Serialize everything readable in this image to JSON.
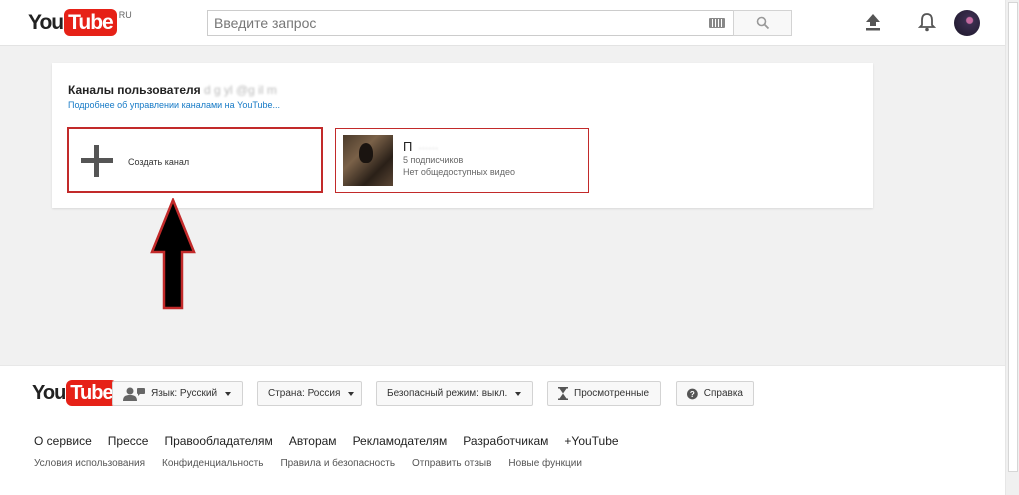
{
  "header": {
    "logo_you": "You",
    "logo_tube": "Tube",
    "logo_region": "RU",
    "search_placeholder": "Введите запрос",
    "icons": [
      "keyboard-icon",
      "search-icon",
      "upload-icon",
      "bell-icon"
    ]
  },
  "card": {
    "title_prefix": "Каналы пользователя",
    "title_hidden": "d g yl @g il m",
    "link": "Подробнее об управлении каналами на YouTube...",
    "create_label": "Создать канал",
    "channel": {
      "name": "П",
      "name_hidden": "······",
      "subscribers": "5 подписчиков",
      "videos": "Нет общедоступных видео"
    }
  },
  "footer": {
    "logo_you": "You",
    "logo_tube": "Tube",
    "lang_button": "Язык: Русский",
    "country_button": "Страна: Россия",
    "safe_button": "Безопасный режим: выкл.",
    "history_button": "Просмотренные",
    "help_button": "Справка",
    "primary_links": [
      "О сервисе",
      "Прессе",
      "Правообладателям",
      "Авторам",
      "Рекламодателям",
      "Разработчикам",
      "+YouTube"
    ],
    "secondary_links": [
      "Условия использования",
      "Конфиденциальность",
      "Правила и безопасность",
      "Отправить отзыв",
      "Новые функции"
    ]
  },
  "colors": {
    "brand_red": "#e62117",
    "highlight_border": "#c22a2a",
    "link_blue": "#167ac6",
    "page_bg": "#f1f1f1"
  }
}
